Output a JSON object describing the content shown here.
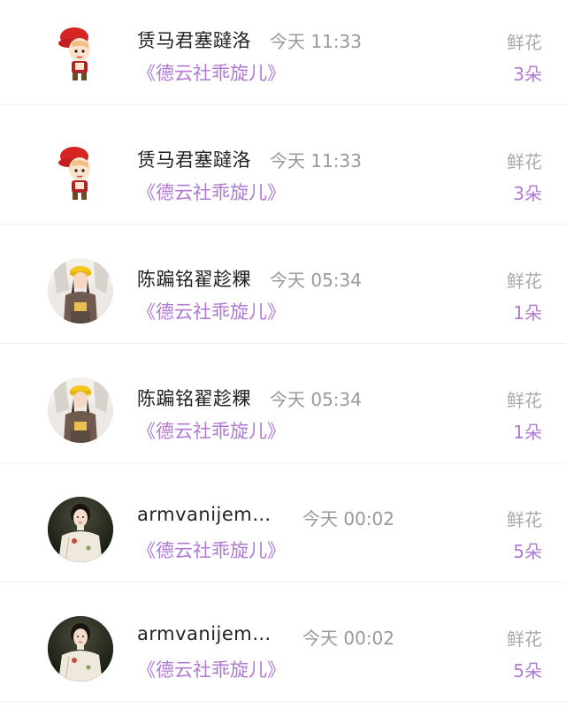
{
  "gift_list": [
    {
      "avatar_icon": "cartoon-boy-red-hat-avatar",
      "username": "赁马君塞躂洛",
      "time": "今天 11:33",
      "work_title": "《德云社乖旋儿》",
      "gift_label": "鲜花",
      "gift_count": "3朵"
    },
    {
      "avatar_icon": "cartoon-boy-red-hat-avatar",
      "username": "赁马君塞躂洛",
      "time": "今天 11:33",
      "work_title": "《德云社乖旋儿》",
      "gift_label": "鲜花",
      "gift_count": "3朵"
    },
    {
      "avatar_icon": "girl-yellow-hat-photo-avatar",
      "username": "陈蹁铭翟趁粿",
      "time": "今天 05:34",
      "work_title": "《德云社乖旋儿》",
      "gift_label": "鲜花",
      "gift_count": "1朵"
    },
    {
      "avatar_icon": "girl-yellow-hat-photo-avatar",
      "username": "陈蹁铭翟趁粿",
      "time": "今天 05:34",
      "work_title": "《德云社乖旋儿》",
      "gift_label": "鲜花",
      "gift_count": "1朵"
    },
    {
      "avatar_icon": "woman-qipao-photo-avatar",
      "username": "armvanijemu···",
      "time": "今天 00:02",
      "work_title": "《德云社乖旋儿》",
      "gift_label": "鲜花",
      "gift_count": "5朵"
    },
    {
      "avatar_icon": "woman-qipao-photo-avatar",
      "username": "armvanijemu···",
      "time": "今天 00:02",
      "work_title": "《德云社乖旋儿》",
      "gift_label": "鲜花",
      "gift_count": "5朵"
    }
  ],
  "colors": {
    "accent_purple": "#b07ad3",
    "name_text": "#222222",
    "meta_gray": "#999999",
    "divider": "#f0f0f0"
  }
}
